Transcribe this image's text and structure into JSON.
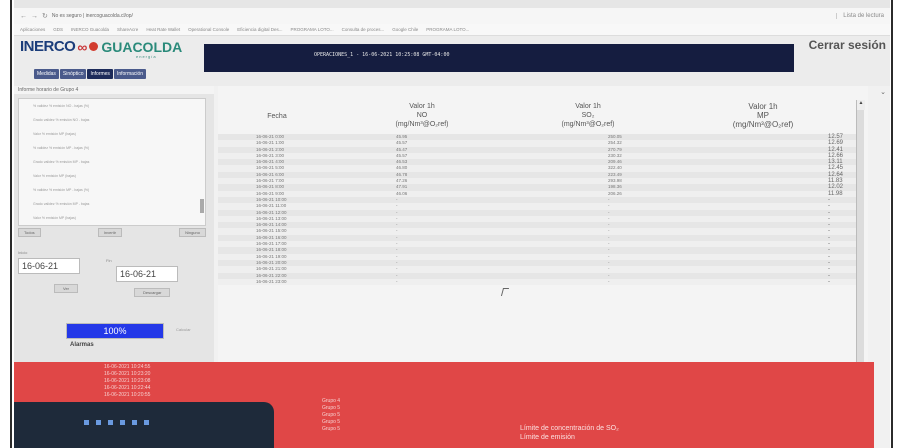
{
  "browser": {
    "url": "No es seguro | inercoguacolda.cl/op/",
    "reading_list": "Lista de lectura",
    "bookmarks": [
      "Aplicaciones",
      "GDS",
      "INERCO Guacolda",
      "ShareAcre",
      "Heat Rate Wallet",
      "Operational Console",
      "Eficiencia digital Des...",
      "PROGRAMA LOTO...",
      "Consulta de proces...",
      "Google Chile",
      "PROGRAMA LOTO..."
    ]
  },
  "app": {
    "logo_inerco": "INERCO",
    "logo_guacolda": "GUACOLDA",
    "logo_energia": "energía",
    "header_title": "OPERACIONES_1 - 16-06-2021 10:25:08 GMT-04:00",
    "logout": "Cerrar sesión",
    "menu": [
      "Medidas",
      "Sinóptico",
      "Informes",
      "Información"
    ]
  },
  "left_panel": {
    "title": "Informe horario de Grupo 4",
    "options": [
      "% validez % emisión NO - bajas (%)",
      "Grado validez % emisión NO - bajas",
      "Valor % emisión MP (bajas)",
      "% validez % emisión MP - bajas (%)",
      "Grado validez % emisión MP - bajas",
      "Valor % emisión MP (bajas)",
      "% validez % emisión MP - bajas (%)",
      "Grado validez % emisión MP - bajas",
      "Valor % emisión MP (bajas)"
    ],
    "buttons": [
      "Todos",
      "Invertir",
      "Ninguno"
    ],
    "start_label": "Inicio",
    "end_label": "Fin",
    "start_date": "16-06-21",
    "end_date": "16-06-21",
    "view_button": "Ver",
    "download_button": "Descargar",
    "progress": "100%",
    "calculate": "Calcular",
    "alarms_title": "Alarmas"
  },
  "table": {
    "headers": {
      "fecha": "Fecha",
      "no": [
        "Valor 1h",
        "NO",
        "(mg/Nm³@O₂ref)"
      ],
      "so": [
        "Valor 1h",
        "SO₂",
        "(mg/Nm³@O₂ref)"
      ],
      "mp": [
        "Valor 1h",
        "MP",
        "(mg/Nm³@O₂ref)"
      ]
    },
    "rows": [
      {
        "date": "16-06-21 0:00",
        "no": "45.95",
        "so": "250.05",
        "mp": "12.57"
      },
      {
        "date": "16-06-21 1:00",
        "no": "45.57",
        "so": "254.32",
        "mp": "12.69"
      },
      {
        "date": "16-06-21 2:00",
        "no": "45.47",
        "so": "270.79",
        "mp": "12.41"
      },
      {
        "date": "16-06-21 3:00",
        "no": "45.57",
        "so": "230.32",
        "mp": "12.66"
      },
      {
        "date": "16-06-21 4:00",
        "no": "46.53",
        "so": "209.46",
        "mp": "13.11"
      },
      {
        "date": "16-06-21 5:00",
        "no": "46.80",
        "so": "322.40",
        "mp": "12.45"
      },
      {
        "date": "16-06-21 6:00",
        "no": "46.78",
        "so": "223.49",
        "mp": "12.64"
      },
      {
        "date": "16-06-21 7:00",
        "no": "47.26",
        "so": "293.98",
        "mp": "11.83"
      },
      {
        "date": "16-06-21 8:00",
        "no": "47.91",
        "so": "198.36",
        "mp": "12.02"
      },
      {
        "date": "16-06-21 9:00",
        "no": "46.06",
        "so": "206.26",
        "mp": "11.98"
      },
      {
        "date": "16-06-21 10:00",
        "no": "-",
        "so": "-",
        "mp": "-"
      },
      {
        "date": "16-06-21 11:00",
        "no": "-",
        "so": "-",
        "mp": "-"
      },
      {
        "date": "16-06-21 12:00",
        "no": "-",
        "so": "-",
        "mp": "-"
      },
      {
        "date": "16-06-21 13:00",
        "no": "-",
        "so": "-",
        "mp": "-"
      },
      {
        "date": "16-06-21 14:00",
        "no": "-",
        "so": "-",
        "mp": "-"
      },
      {
        "date": "16-06-21 15:00",
        "no": "-",
        "so": "-",
        "mp": "-"
      },
      {
        "date": "16-06-21 16:00",
        "no": "-",
        "so": "-",
        "mp": "-"
      },
      {
        "date": "16-06-21 17:00",
        "no": "-",
        "so": "-",
        "mp": "-"
      },
      {
        "date": "16-06-21 18:00",
        "no": "-",
        "so": "-",
        "mp": "-"
      },
      {
        "date": "16-06-21 19:00",
        "no": "-",
        "so": "-",
        "mp": "-"
      },
      {
        "date": "16-06-21 20:00",
        "no": "-",
        "so": "-",
        "mp": "-"
      },
      {
        "date": "16-06-21 21:00",
        "no": "-",
        "so": "-",
        "mp": "-"
      },
      {
        "date": "16-06-21 22:00",
        "no": "-",
        "so": "-",
        "mp": "-"
      },
      {
        "date": "16-06-21 23:00",
        "no": "-",
        "so": "-",
        "mp": "-"
      }
    ]
  },
  "alarms": {
    "times": [
      "16-06-2021 10:24:55",
      "16-06-2021 10:23:20",
      "16-06-2021 10:23:08",
      "16-06-2021 10:22:44",
      "16-06-2021 10:20:55"
    ],
    "groups": [
      "Grupo 4",
      "Grupo 5",
      "Grupo 5",
      "Grupo 5",
      "Grupo 5"
    ],
    "messages": [
      "Límite de concentración de SO₂",
      "Límite de emisión"
    ]
  },
  "colors": {
    "header_bg": "#151d40",
    "tab_bg": "#4a5a8b",
    "progress_fill": "#2438e8",
    "alarm_bg": "#e04747"
  }
}
